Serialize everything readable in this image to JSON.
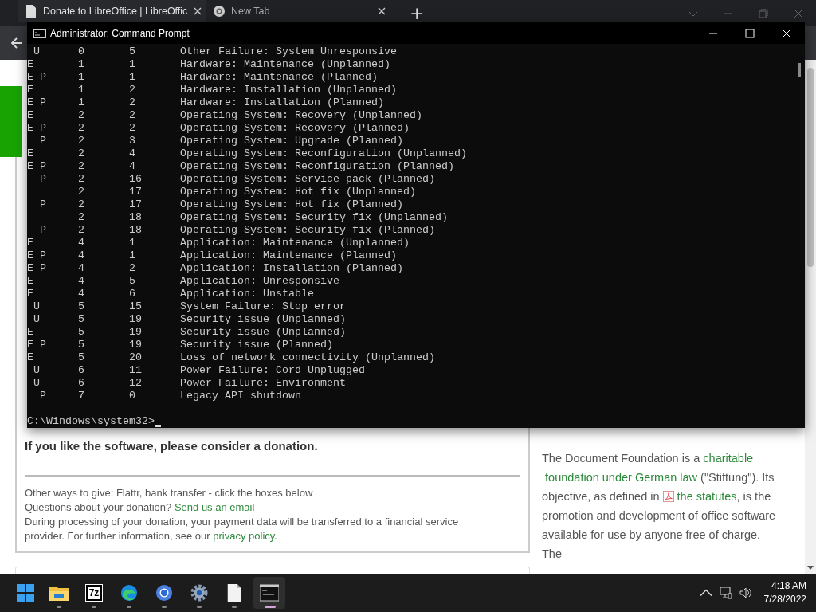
{
  "browser": {
    "tabs": [
      {
        "title": "Donate to LibreOffice | LibreOffic",
        "kind": "page",
        "selected": true
      },
      {
        "title": "New Tab",
        "kind": "chrome",
        "selected": false
      }
    ],
    "new_tab": "+"
  },
  "console": {
    "title": "Administrator: Command Prompt",
    "lines": [
      {
        "flags": " U",
        "major": "0",
        "minor": "5",
        "description": "Other Failure: System Unresponsive"
      },
      {
        "flags": "E",
        "major": "1",
        "minor": "1",
        "description": "Hardware: Maintenance (Unplanned)"
      },
      {
        "flags": "E P",
        "major": "1",
        "minor": "1",
        "description": "Hardware: Maintenance (Planned)"
      },
      {
        "flags": "E",
        "major": "1",
        "minor": "2",
        "description": "Hardware: Installation (Unplanned)"
      },
      {
        "flags": "E P",
        "major": "1",
        "minor": "2",
        "description": "Hardware: Installation (Planned)"
      },
      {
        "flags": "E",
        "major": "2",
        "minor": "2",
        "description": "Operating System: Recovery (Unplanned)"
      },
      {
        "flags": "E P",
        "major": "2",
        "minor": "2",
        "description": "Operating System: Recovery (Planned)"
      },
      {
        "flags": "  P",
        "major": "2",
        "minor": "3",
        "description": "Operating System: Upgrade (Planned)"
      },
      {
        "flags": "E",
        "major": "2",
        "minor": "4",
        "description": "Operating System: Reconfiguration (Unplanned)"
      },
      {
        "flags": "E P",
        "major": "2",
        "minor": "4",
        "description": "Operating System: Reconfiguration (Planned)"
      },
      {
        "flags": "  P",
        "major": "2",
        "minor": "16",
        "description": "Operating System: Service pack (Planned)"
      },
      {
        "major": "2",
        "minor": "17",
        "description": "Operating System: Hot fix (Unplanned)"
      },
      {
        "flags": "  P",
        "major": "2",
        "minor": "17",
        "description": "Operating System: Hot fix (Planned)"
      },
      {
        "major": "2",
        "minor": "18",
        "description": "Operating System: Security fix (Unplanned)"
      },
      {
        "flags": "  P",
        "major": "2",
        "minor": "18",
        "description": "Operating System: Security fix (Planned)"
      },
      {
        "flags": "E",
        "major": "4",
        "minor": "1",
        "description": "Application: Maintenance (Unplanned)"
      },
      {
        "flags": "E P",
        "major": "4",
        "minor": "1",
        "description": "Application: Maintenance (Planned)"
      },
      {
        "flags": "E P",
        "major": "4",
        "minor": "2",
        "description": "Application: Installation (Planned)"
      },
      {
        "flags": "E",
        "major": "4",
        "minor": "5",
        "description": "Application: Unresponsive"
      },
      {
        "flags": "E",
        "major": "4",
        "minor": "6",
        "description": "Application: Unstable"
      },
      {
        "flags": " U",
        "major": "5",
        "minor": "15",
        "description": "System Failure: Stop error"
      },
      {
        "flags": " U",
        "major": "5",
        "minor": "19",
        "description": "Security issue (Unplanned)"
      },
      {
        "flags": "E",
        "major": "5",
        "minor": "19",
        "description": "Security issue (Unplanned)"
      },
      {
        "flags": "E P",
        "major": "5",
        "minor": "19",
        "description": "Security issue (Planned)"
      },
      {
        "flags": "E",
        "major": "5",
        "minor": "20",
        "description": "Loss of network connectivity (Unplanned)"
      },
      {
        "flags": " U",
        "major": "6",
        "minor": "11",
        "description": "Power Failure: Cord Unplugged"
      },
      {
        "flags": " U",
        "major": "6",
        "minor": "12",
        "description": "Power Failure: Environment"
      },
      {
        "flags": "  P",
        "major": "7",
        "minor": "0",
        "description": "Legacy API shutdown"
      }
    ],
    "prompt": "C:\\Windows\\system32>"
  },
  "donation_card": {
    "lead": "If you like the software, please consider a donation.",
    "lines": [
      [
        {
          "kind": "text",
          "text": "Other ways to give: Flattr, bank transfer - click the boxes below"
        }
      ],
      [
        {
          "kind": "text",
          "text": "Questions about your donation? "
        },
        {
          "kind": "link",
          "text": "Send us an email"
        }
      ],
      [
        {
          "kind": "text",
          "text": "During processing of your donation, your payment data will be transferred to a financial service provider. For further information, see our "
        },
        {
          "kind": "link",
          "text": "privacy policy"
        },
        {
          "kind": "text",
          "text": "."
        }
      ]
    ]
  },
  "foundation": {
    "paragraph": [
      {
        "kind": "text",
        "text": "The Document Foundation is a "
      },
      {
        "kind": "link",
        "text": "charitable"
      },
      {
        "kind": "link",
        "text": "foundation under German law"
      },
      {
        "kind": "text",
        "text": " (\"Stiftung\"). Its objective, as defined in "
      },
      {
        "kind": "pdf-link",
        "text": "the statutes"
      },
      {
        "kind": "text",
        "text": ", is the promotion and development of office software available for use by anyone free of charge. The"
      }
    ]
  },
  "taskbar": {
    "apps": [
      {
        "kind": "folder",
        "selected": false
      },
      {
        "kind": "archive",
        "label": "7z",
        "selected": false
      },
      {
        "kind": "edge",
        "selected": false
      },
      {
        "kind": "chrome",
        "selected": false
      },
      {
        "kind": "gear",
        "selected": false
      },
      {
        "kind": "document",
        "selected": false
      },
      {
        "kind": "terminal",
        "selected": true
      }
    ],
    "time": "4:18 AM",
    "date": "7/28/2022"
  }
}
